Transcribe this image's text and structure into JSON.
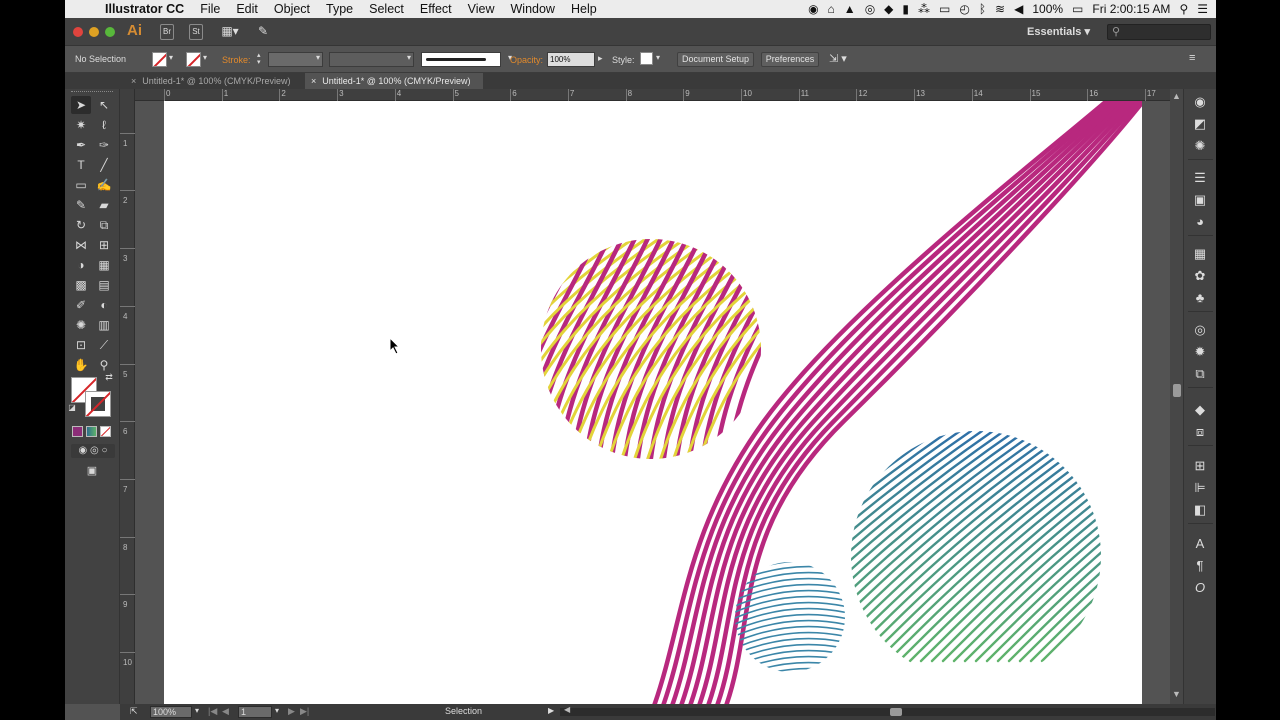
{
  "menubar": {
    "app_name": "Illustrator CC",
    "items": [
      "File",
      "Edit",
      "Object",
      "Type",
      "Select",
      "Effect",
      "View",
      "Window",
      "Help"
    ],
    "battery": "100%",
    "clock": "Fri 2:00:15 AM"
  },
  "appbar": {
    "logo": "Ai",
    "bridge": "Br",
    "stock": "St",
    "workspace": "Essentials"
  },
  "control": {
    "selection": "No Selection",
    "stroke_label": "Stroke:",
    "opacity_label": "Opacity:",
    "opacity_value": "100%",
    "style_label": "Style:",
    "document_setup": "Document Setup",
    "preferences": "Preferences"
  },
  "tabs": [
    {
      "label": "Untitled-1* @ 100% (CMYK/Preview)",
      "active": false
    },
    {
      "label": "Untitled-1* @ 100% (CMYK/Preview)",
      "active": true
    }
  ],
  "ruler": {
    "top_labels": [
      "0",
      "1",
      "2",
      "3",
      "4",
      "5",
      "6",
      "7",
      "8",
      "9",
      "10",
      "11",
      "12",
      "13",
      "14",
      "15",
      "16",
      "17"
    ],
    "left_labels": [
      "1",
      "2",
      "3",
      "4",
      "5",
      "6",
      "7",
      "8",
      "9",
      "10"
    ]
  },
  "status": {
    "zoom": "100%",
    "artboard": "1",
    "tool": "Selection"
  },
  "colors": {
    "magenta": "#b8287e",
    "yellow": "#e3d43a",
    "teal": "#3b86a8",
    "green": "#5fb36a"
  }
}
